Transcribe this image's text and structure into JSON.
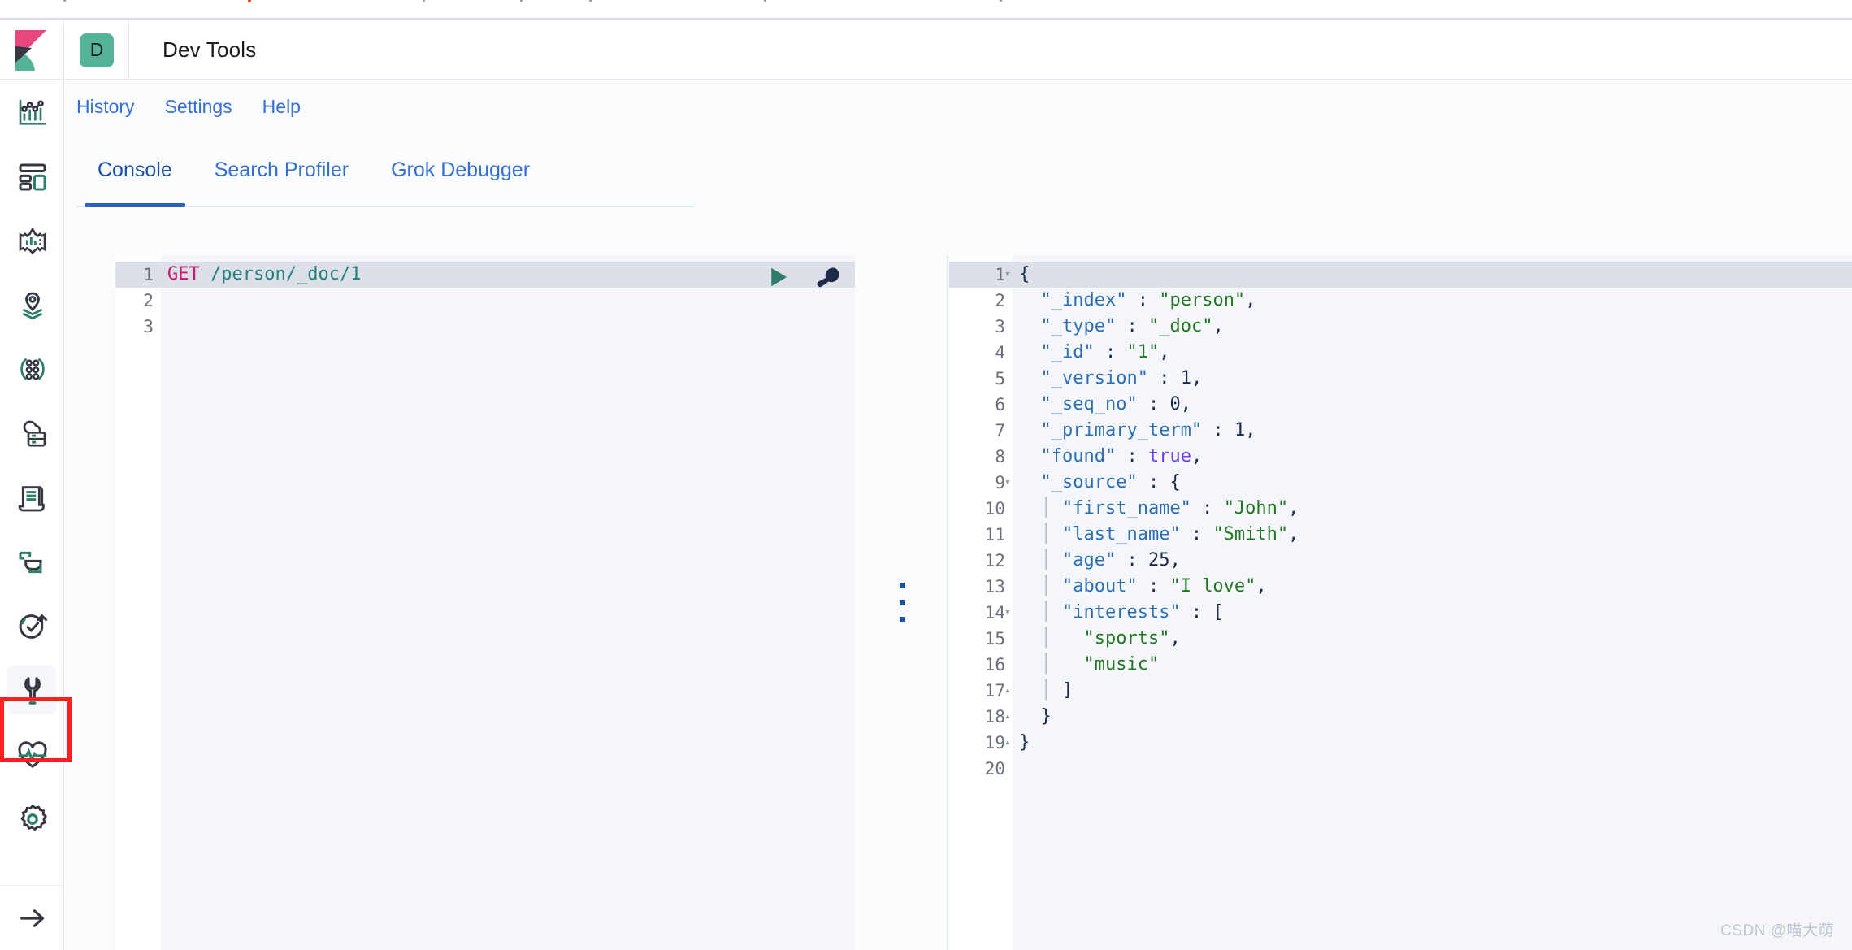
{
  "browser": {
    "strip_visible": true
  },
  "header": {
    "logo_name": "kibana-logo",
    "app_badge_letter": "D",
    "title": "Dev Tools"
  },
  "nav_links": [
    {
      "label": "History",
      "name": "history-link"
    },
    {
      "label": "Settings",
      "name": "settings-link"
    },
    {
      "label": "Help",
      "name": "help-link"
    }
  ],
  "tabs": [
    {
      "label": "Console",
      "active": true
    },
    {
      "label": "Search Profiler",
      "active": false
    },
    {
      "label": "Grok Debugger",
      "active": false
    }
  ],
  "sidebar": {
    "items": [
      {
        "name": "sidebar-item-discover",
        "icon": "analytics-icon",
        "label": "Analytics"
      },
      {
        "name": "sidebar-item-dashboard",
        "icon": "dashboard-icon",
        "label": "Dashboard"
      },
      {
        "name": "sidebar-item-canvas",
        "icon": "canvas-icon",
        "label": "Canvas"
      },
      {
        "name": "sidebar-item-maps",
        "icon": "maps-icon",
        "label": "Maps"
      },
      {
        "name": "sidebar-item-machine-learning",
        "icon": "machine-learning-icon",
        "label": "Machine Learning"
      },
      {
        "name": "sidebar-item-enterprise-search",
        "icon": "cloud-database-icon",
        "label": "Enterprise Search"
      },
      {
        "name": "sidebar-item-logs",
        "icon": "document-scroll-icon",
        "label": "Logs"
      },
      {
        "name": "sidebar-item-apm",
        "icon": "apm-icon",
        "label": "APM"
      },
      {
        "name": "sidebar-item-uptime",
        "icon": "uptime-icon",
        "label": "Uptime"
      },
      {
        "name": "sidebar-item-dev-tools",
        "icon": "wrench-icon",
        "label": "Dev Tools",
        "active": true,
        "annotated": true
      },
      {
        "name": "sidebar-item-monitoring",
        "icon": "heartbeat-icon",
        "label": "Stack Monitoring"
      },
      {
        "name": "sidebar-item-management",
        "icon": "gear-icon",
        "label": "Management"
      }
    ],
    "collapse_toggle": {
      "name": "expand-arrow-icon",
      "label": "Expand"
    }
  },
  "console": {
    "request_editor": {
      "actions": [
        {
          "name": "send-request-button",
          "icon": "play-icon",
          "color": "#2e7d6b"
        },
        {
          "name": "open-documentation-button",
          "icon": "wrench-icon",
          "color": "#1c2b4a"
        }
      ],
      "line_numbers": [
        "1",
        "2",
        "3"
      ],
      "active_line": 1,
      "lines": [
        {
          "n": 1,
          "tokens": [
            {
              "t": "GET",
              "c": "method"
            },
            {
              "t": " ",
              "c": "punc"
            },
            {
              "t": "/person/_doc/1",
              "c": "url"
            }
          ]
        },
        {
          "n": 2,
          "tokens": []
        },
        {
          "n": 3,
          "tokens": []
        }
      ]
    },
    "response_editor": {
      "active_line": 1,
      "line_numbers": [
        "1",
        "2",
        "3",
        "4",
        "5",
        "6",
        "7",
        "8",
        "9",
        "10",
        "11",
        "12",
        "13",
        "14",
        "15",
        "16",
        "17",
        "18",
        "19",
        "20"
      ],
      "folds": {
        "1": "down",
        "9": "down",
        "14": "down",
        "17": "up",
        "18": "up",
        "19": "up"
      },
      "lines": [
        {
          "n": 1,
          "indent": 0,
          "guide": false,
          "tokens": [
            {
              "t": "{",
              "c": "punc"
            }
          ]
        },
        {
          "n": 2,
          "indent": 1,
          "guide": false,
          "tokens": [
            {
              "t": "\"_index\"",
              "c": "key"
            },
            {
              "t": " : ",
              "c": "punc"
            },
            {
              "t": "\"person\"",
              "c": "str"
            },
            {
              "t": ",",
              "c": "punc"
            }
          ]
        },
        {
          "n": 3,
          "indent": 1,
          "guide": false,
          "tokens": [
            {
              "t": "\"_type\"",
              "c": "key"
            },
            {
              "t": " : ",
              "c": "punc"
            },
            {
              "t": "\"_doc\"",
              "c": "str"
            },
            {
              "t": ",",
              "c": "punc"
            }
          ]
        },
        {
          "n": 4,
          "indent": 1,
          "guide": false,
          "tokens": [
            {
              "t": "\"_id\"",
              "c": "key"
            },
            {
              "t": " : ",
              "c": "punc"
            },
            {
              "t": "\"1\"",
              "c": "str"
            },
            {
              "t": ",",
              "c": "punc"
            }
          ]
        },
        {
          "n": 5,
          "indent": 1,
          "guide": false,
          "tokens": [
            {
              "t": "\"_version\"",
              "c": "key"
            },
            {
              "t": " : ",
              "c": "punc"
            },
            {
              "t": "1",
              "c": "num"
            },
            {
              "t": ",",
              "c": "punc"
            }
          ]
        },
        {
          "n": 6,
          "indent": 1,
          "guide": false,
          "tokens": [
            {
              "t": "\"_seq_no\"",
              "c": "key"
            },
            {
              "t": " : ",
              "c": "punc"
            },
            {
              "t": "0",
              "c": "num"
            },
            {
              "t": ",",
              "c": "punc"
            }
          ]
        },
        {
          "n": 7,
          "indent": 1,
          "guide": false,
          "tokens": [
            {
              "t": "\"_primary_term\"",
              "c": "key"
            },
            {
              "t": " : ",
              "c": "punc"
            },
            {
              "t": "1",
              "c": "num"
            },
            {
              "t": ",",
              "c": "punc"
            }
          ]
        },
        {
          "n": 8,
          "indent": 1,
          "guide": false,
          "tokens": [
            {
              "t": "\"found\"",
              "c": "key"
            },
            {
              "t": " : ",
              "c": "punc"
            },
            {
              "t": "true",
              "c": "bool"
            },
            {
              "t": ",",
              "c": "punc"
            }
          ]
        },
        {
          "n": 9,
          "indent": 1,
          "guide": false,
          "tokens": [
            {
              "t": "\"_source\"",
              "c": "key"
            },
            {
              "t": " : ",
              "c": "punc"
            },
            {
              "t": "{",
              "c": "punc"
            }
          ]
        },
        {
          "n": 10,
          "indent": 2,
          "guide": true,
          "tokens": [
            {
              "t": "\"first_name\"",
              "c": "key"
            },
            {
              "t": " : ",
              "c": "punc"
            },
            {
              "t": "\"John\"",
              "c": "str"
            },
            {
              "t": ",",
              "c": "punc"
            }
          ]
        },
        {
          "n": 11,
          "indent": 2,
          "guide": true,
          "tokens": [
            {
              "t": "\"last_name\"",
              "c": "key"
            },
            {
              "t": " : ",
              "c": "punc"
            },
            {
              "t": "\"Smith\"",
              "c": "str"
            },
            {
              "t": ",",
              "c": "punc"
            }
          ]
        },
        {
          "n": 12,
          "indent": 2,
          "guide": true,
          "tokens": [
            {
              "t": "\"age\"",
              "c": "key"
            },
            {
              "t": " : ",
              "c": "punc"
            },
            {
              "t": "25",
              "c": "num"
            },
            {
              "t": ",",
              "c": "punc"
            }
          ]
        },
        {
          "n": 13,
          "indent": 2,
          "guide": true,
          "tokens": [
            {
              "t": "\"about\"",
              "c": "key"
            },
            {
              "t": " : ",
              "c": "punc"
            },
            {
              "t": "\"I love\"",
              "c": "str"
            },
            {
              "t": ",",
              "c": "punc"
            }
          ]
        },
        {
          "n": 14,
          "indent": 2,
          "guide": true,
          "tokens": [
            {
              "t": "\"interests\"",
              "c": "key"
            },
            {
              "t": " : ",
              "c": "punc"
            },
            {
              "t": "[",
              "c": "punc"
            }
          ]
        },
        {
          "n": 15,
          "indent": 3,
          "guide": true,
          "tokens": [
            {
              "t": "\"sports\"",
              "c": "str"
            },
            {
              "t": ",",
              "c": "punc"
            }
          ]
        },
        {
          "n": 16,
          "indent": 3,
          "guide": true,
          "tokens": [
            {
              "t": "\"music\"",
              "c": "str"
            }
          ]
        },
        {
          "n": 17,
          "indent": 2,
          "guide": true,
          "tokens": [
            {
              "t": "]",
              "c": "punc"
            }
          ]
        },
        {
          "n": 18,
          "indent": 1,
          "guide": false,
          "tokens": [
            {
              "t": "}",
              "c": "punc"
            }
          ]
        },
        {
          "n": 19,
          "indent": 0,
          "guide": false,
          "tokens": [
            {
              "t": "}",
              "c": "punc"
            }
          ]
        },
        {
          "n": 20,
          "indent": 0,
          "guide": false,
          "tokens": []
        }
      ]
    },
    "splitter": {
      "name": "pane-resize-handle",
      "dots": 3
    }
  },
  "watermark": {
    "text": "CSDN @喵大萌"
  },
  "colors": {
    "accent_teal": "#54b399",
    "accent_pink": "#e7477f",
    "link_blue": "#356fd4",
    "tab_underline": "#2c5fc2",
    "annotation_red": "#fb2121",
    "editor_bg": "#f4f6fb",
    "active_line": "#dcdfe8"
  }
}
